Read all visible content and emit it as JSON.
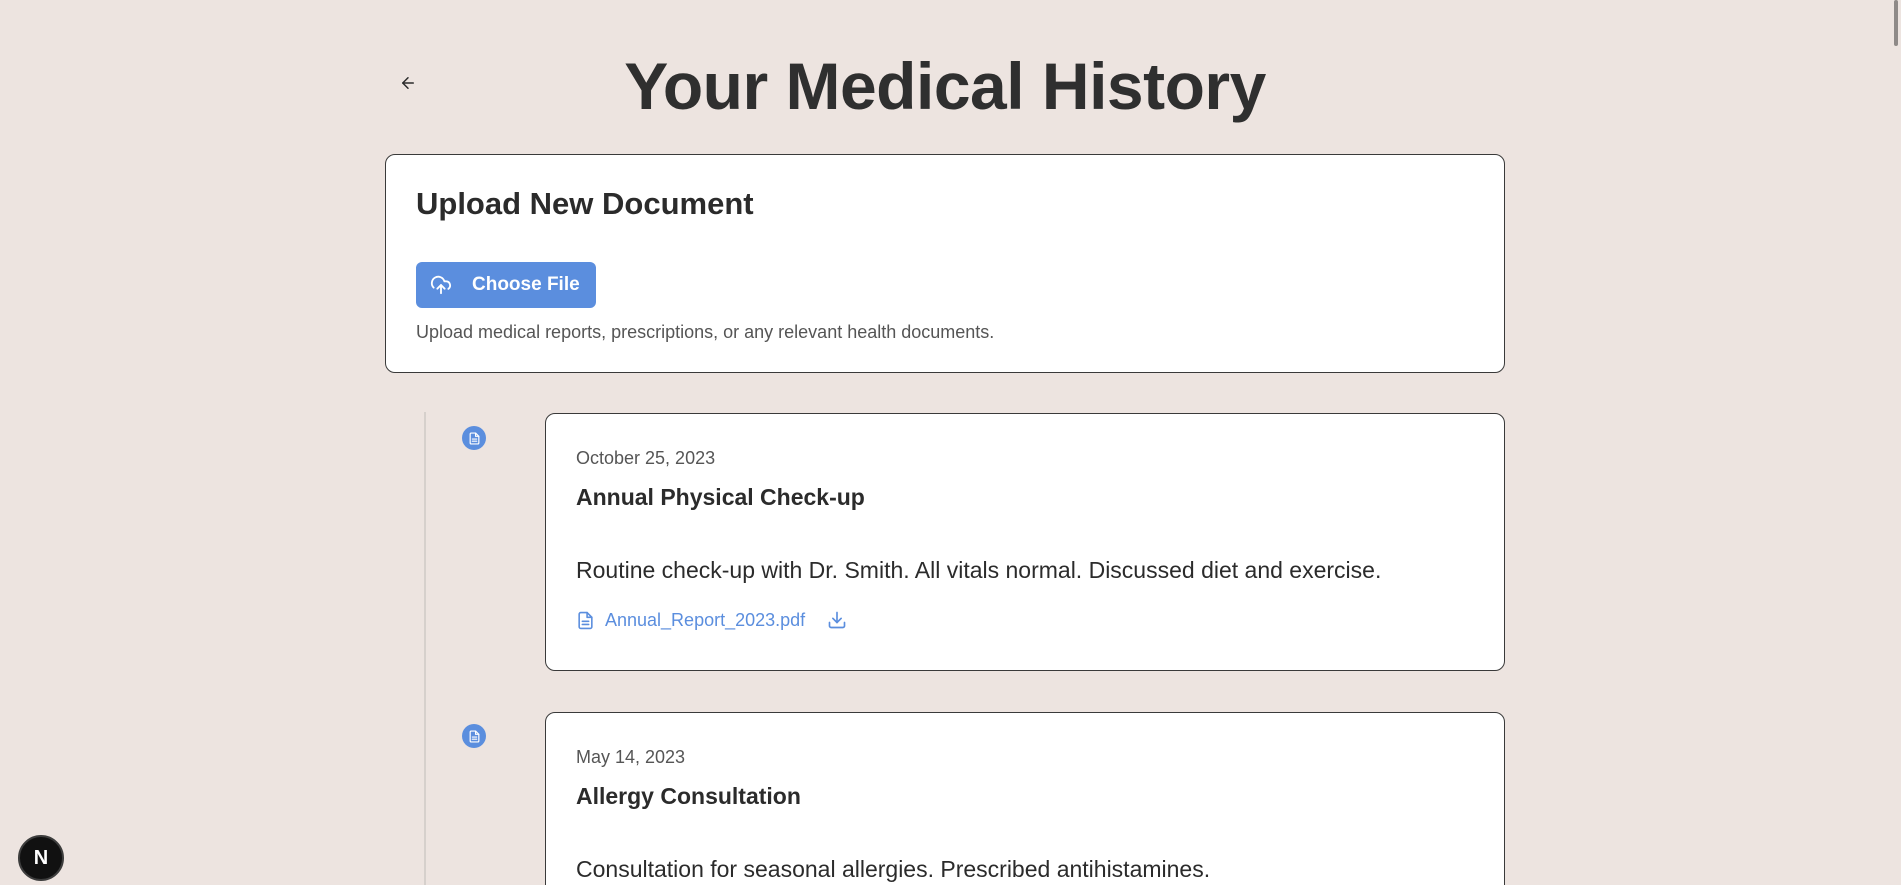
{
  "header": {
    "back_icon": "arrow-left-icon",
    "title": "Your Medical History"
  },
  "upload": {
    "title": "Upload New Document",
    "button_label": "Choose File",
    "button_icon": "cloud-upload-icon",
    "help_text": "Upload medical reports, prescriptions, or any relevant health documents."
  },
  "records": [
    {
      "date": "October 25, 2023",
      "title": "Annual Physical Check-up",
      "description": "Routine check-up with Dr. Smith. All vitals normal. Discussed diet and exercise.",
      "file_name": "Annual_Report_2023.pdf",
      "file_icon": "file-text-icon",
      "download_icon": "download-icon"
    },
    {
      "date": "May 14, 2023",
      "title": "Allergy Consultation",
      "description": "Consultation for seasonal allergies. Prescribed antihistamines."
    }
  ],
  "dev_badge": {
    "label": "N"
  },
  "colors": {
    "background": "#ede4e0",
    "accent": "#5b8ede",
    "card": "#ffffff",
    "text": "#2b2b2b"
  }
}
